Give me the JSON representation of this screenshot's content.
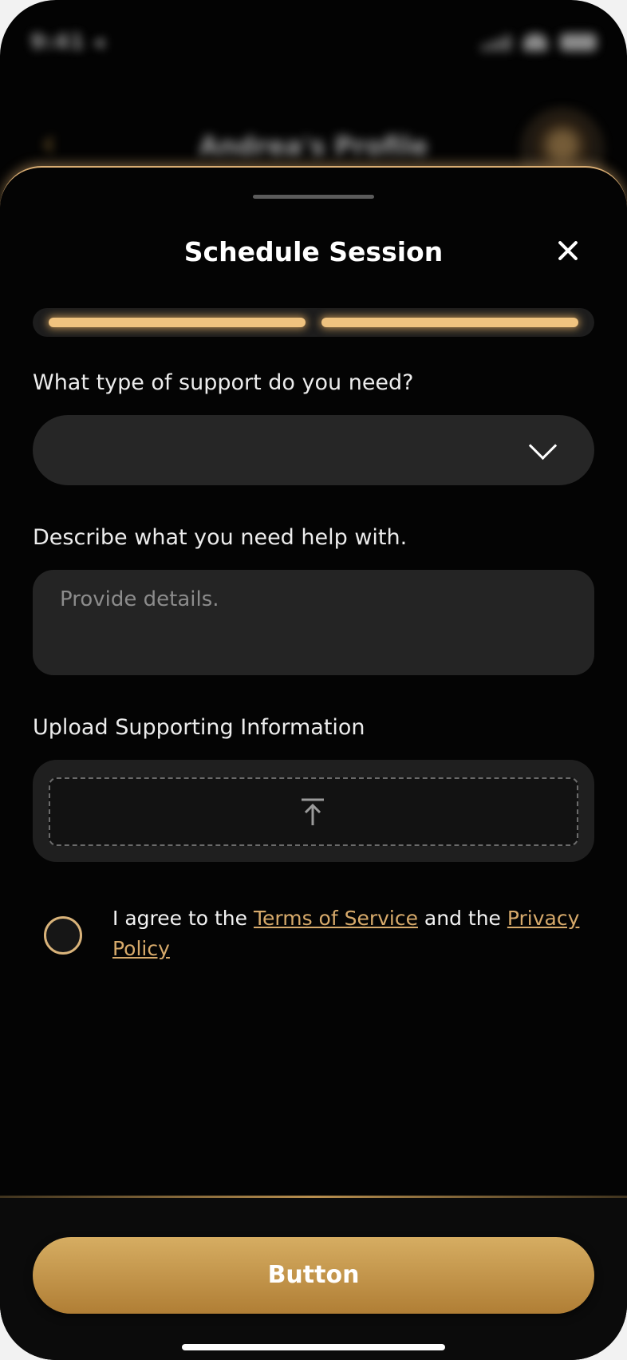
{
  "background": {
    "profile_title": "Andrea's Profile"
  },
  "sheet": {
    "title": "Schedule Session",
    "progress": {
      "steps_total": 2,
      "steps_filled": 2
    },
    "support_type": {
      "label": "What type of support do you need?",
      "value": ""
    },
    "description": {
      "label": "Describe what you need help with.",
      "placeholder": "Provide details."
    },
    "upload": {
      "label": "Upload Supporting Information"
    },
    "agreement": {
      "prefix": "I agree to the ",
      "terms": "Terms of Service",
      "middle": " and the ",
      "privacy": "Privacy Policy",
      "checked": false
    },
    "button_label": "Button"
  },
  "colors": {
    "accent": "#d7aa6b",
    "button": "#c49a50",
    "sheet_bg": "#040404"
  }
}
